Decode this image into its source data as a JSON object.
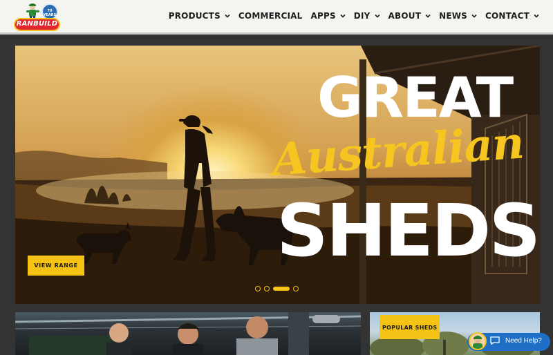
{
  "brand": {
    "logo_text": "RANBUILD",
    "years_badge": "70 YEARS"
  },
  "nav": {
    "items": [
      {
        "label": "PRODUCTS",
        "dropdown": true
      },
      {
        "label": "COMMERCIAL",
        "dropdown": false
      },
      {
        "label": "APPS",
        "dropdown": true
      },
      {
        "label": "DIY",
        "dropdown": true
      },
      {
        "label": "ABOUT",
        "dropdown": true
      },
      {
        "label": "NEWS",
        "dropdown": true
      },
      {
        "label": "CONTACT",
        "dropdown": true
      }
    ]
  },
  "hero": {
    "line1": "GREAT",
    "line2": "Australian",
    "line3": "SHEDS",
    "cta_label": "VIEW RANGE",
    "slides": 4,
    "active_slide": 3
  },
  "popular": {
    "tag_label": "POPULAR SHEDS"
  },
  "help": {
    "label": "Need Help?"
  },
  "colors": {
    "accent": "#f5c216",
    "header_bg": "#f4f4f1",
    "page_bg": "#333333",
    "help_blue": "#1f6fc6",
    "brand_red": "#e2262f"
  }
}
